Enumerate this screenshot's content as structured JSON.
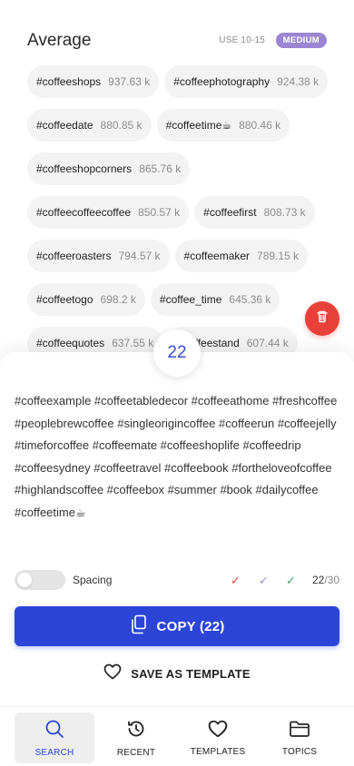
{
  "section": {
    "title": "Average",
    "use_range": "USE 10-15",
    "level_badge": "MEDIUM",
    "level_color": "#9b86d3"
  },
  "chips": [
    [
      {
        "tag": "#coffeeshops",
        "count": "937.63 k"
      },
      {
        "tag": "#coffeephotography",
        "count": "924.38 k"
      }
    ],
    [
      {
        "tag": "#coffeedate",
        "count": "880.85 k"
      },
      {
        "tag": "#coffeetime☕",
        "count": "880.46 k"
      }
    ],
    [
      {
        "tag": "#coffeeshopcorners",
        "count": "865.76 k"
      }
    ],
    [
      {
        "tag": "#coffeecoffeecoffee",
        "count": "850.57 k"
      },
      {
        "tag": "#coffeefirst",
        "count": "808.73 k"
      }
    ],
    [
      {
        "tag": "#coffeeroasters",
        "count": "794.57 k"
      },
      {
        "tag": "#coffeemaker",
        "count": "789.15 k"
      }
    ],
    [
      {
        "tag": "#coffeetogo",
        "count": "698.2 k"
      },
      {
        "tag": "#coffee_time",
        "count": "645.36 k"
      }
    ],
    [
      {
        "tag": "#coffeequotes",
        "count": "637.55 k"
      },
      {
        "tag": "#coffeestand",
        "count": "607.44 k"
      }
    ]
  ],
  "selection": {
    "count": "22",
    "text": "#coffeexample #coffeetabledecor #coffeeathome #freshcoffee #peoplebrewcoffee #singleorigincoffee #coffeerun #coffeejelly #timeforcoffee #coffeemate #coffeeshoplife #coffeedrip #coffeesydney #coffeetravel #coffeebook #fortheloveofcoffee #highlandscoffee #coffeebox #summer #book #dailycoffee #coffeetime☕"
  },
  "controls": {
    "spacing_label": "Spacing",
    "spacing_enabled": false,
    "check_mark": "✓",
    "counter_current": "22",
    "counter_max": "/30"
  },
  "actions": {
    "copy_label": "COPY (22)",
    "save_template_label": "SAVE AS TEMPLATE"
  },
  "nav": {
    "items": [
      {
        "label": "SEARCH",
        "icon": "search-icon",
        "active": true
      },
      {
        "label": "RECENT",
        "icon": "history-icon",
        "active": false
      },
      {
        "label": "TEMPLATES",
        "icon": "heart-icon",
        "active": false
      },
      {
        "label": "TOPICS",
        "icon": "folder-icon",
        "active": false
      }
    ]
  },
  "colors": {
    "accent_blue": "#2c45d7",
    "delete_red": "#e9413a",
    "medium_purple": "#9b86d3"
  }
}
